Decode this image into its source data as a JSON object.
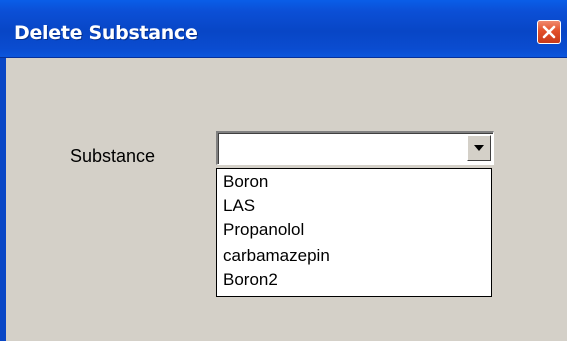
{
  "window": {
    "title": "Delete Substance",
    "close_icon": "close-icon",
    "colors": {
      "title_bar": "#0846c6",
      "dialog_bg": "#d4d0c8",
      "close_button": "#e2502a"
    }
  },
  "form": {
    "substance_label": "Substance",
    "substance_value": "",
    "dropdown_icon": "chevron-down-icon",
    "options": [
      "Boron",
      "LAS",
      "Propanolol",
      "carbamazepin",
      "Boron2"
    ]
  }
}
